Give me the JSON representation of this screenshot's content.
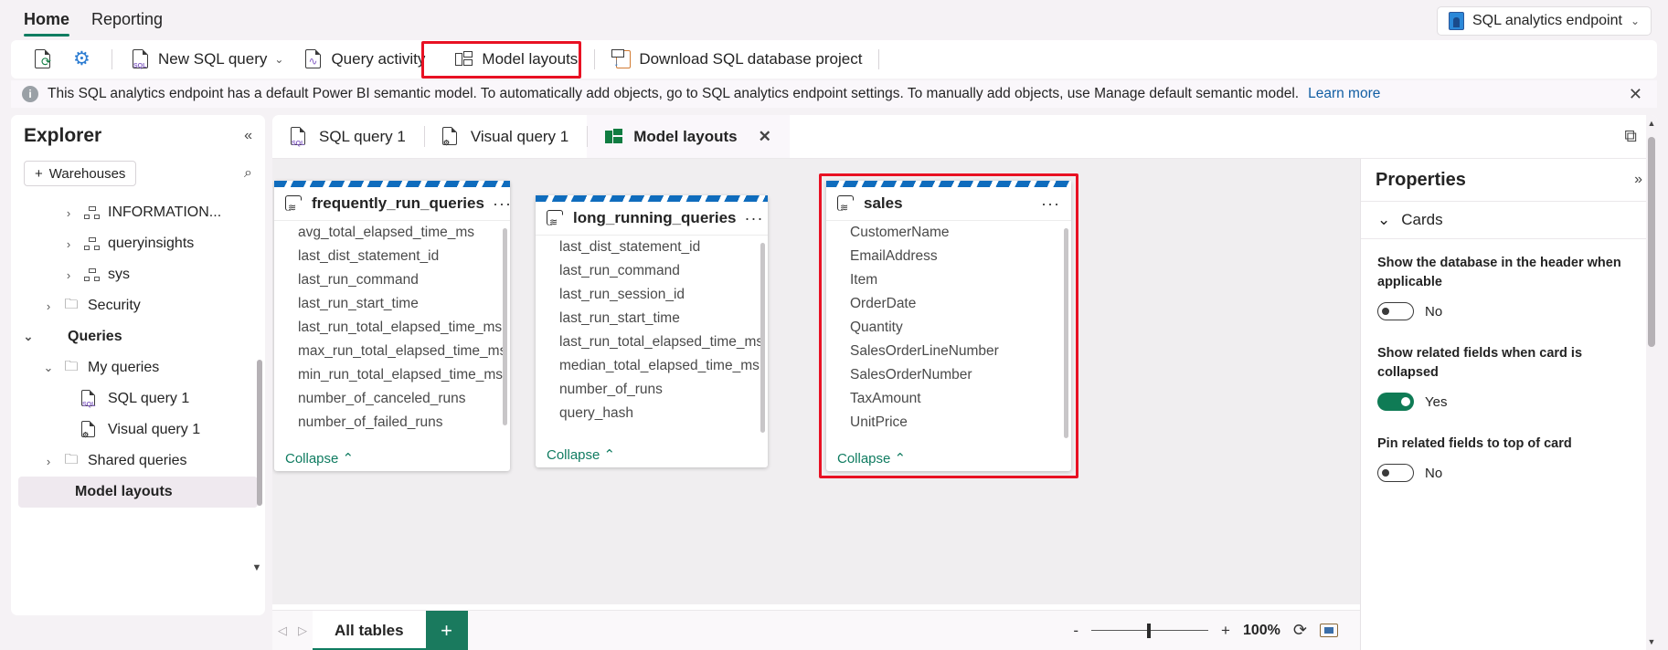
{
  "ribbon": {
    "tabs": [
      {
        "label": "Home",
        "active": true
      },
      {
        "label": "Reporting",
        "active": false
      }
    ],
    "endpoint": {
      "label": "SQL analytics endpoint",
      "icon": "database-icon",
      "chevron": "⌄"
    }
  },
  "commandbar": {
    "items": [
      {
        "label": "",
        "icon": "refresh-page-icon"
      },
      {
        "label": "",
        "icon": "settings-gear-icon"
      },
      {
        "label": "New SQL query",
        "icon": "new-sql-query-icon",
        "chevron": "⌄"
      },
      {
        "label": "Query activity",
        "icon": "query-activity-icon"
      },
      {
        "label": "Model layouts",
        "icon": "model-layouts-icon",
        "highlighted": true
      },
      {
        "label": "Download SQL database project",
        "icon": "download-project-icon"
      }
    ]
  },
  "banner": {
    "icon": "info-icon",
    "text": "This SQL analytics endpoint has a default Power BI semantic model. To automatically add objects, go to SQL analytics endpoint settings. To manually add objects, use Manage default semantic model.",
    "link": "Learn more",
    "close": "✕"
  },
  "explorer": {
    "title": "Explorer",
    "collapse_icon": "«",
    "warehouses_button": "Warehouses",
    "plus": "+",
    "search_icon": "search-icon",
    "tree": [
      {
        "label": "INFORMATION...",
        "caret": "›",
        "icon": "schema-icon",
        "indent": 2,
        "selected": false
      },
      {
        "label": "queryinsights",
        "caret": "›",
        "icon": "schema-icon",
        "indent": 2,
        "selected": false
      },
      {
        "label": "sys",
        "caret": "›",
        "icon": "schema-icon",
        "indent": 2,
        "selected": false
      },
      {
        "label": "Security",
        "caret": "›",
        "icon": "folder-icon",
        "indent": 1,
        "selected": false
      },
      {
        "label": "Queries",
        "caret": "⌄",
        "icon": "",
        "indent": 0,
        "selected": false,
        "bold": true
      },
      {
        "label": "My queries",
        "caret": "⌄",
        "icon": "folder-icon",
        "indent": 1,
        "selected": false
      },
      {
        "label": "SQL query 1",
        "caret": "",
        "icon": "sql-query-icon",
        "indent": 2,
        "selected": false
      },
      {
        "label": "Visual query 1",
        "caret": "",
        "icon": "visual-query-icon",
        "indent": 2,
        "selected": false
      },
      {
        "label": "Shared queries",
        "caret": "›",
        "icon": "folder-icon",
        "indent": 1,
        "selected": false
      },
      {
        "label": "Model layouts",
        "caret": "",
        "icon": "",
        "indent": 0,
        "selected": true
      }
    ]
  },
  "editor": {
    "tabs": [
      {
        "label": "SQL query 1",
        "icon": "sql-query-icon",
        "active": false,
        "closable": false
      },
      {
        "label": "Visual query 1",
        "icon": "visual-query-icon",
        "active": false,
        "closable": false
      },
      {
        "label": "Model layouts",
        "icon": "model-layouts-icon",
        "active": true,
        "closable": true,
        "close": "✕"
      }
    ],
    "copy_icon": "copy-icon"
  },
  "cards": [
    {
      "name": "frequently_run_queries",
      "icon": "table-icon",
      "more": "···",
      "collapse": "Collapse",
      "collapse_caret": "⌃",
      "fields": [
        "avg_total_elapsed_time_ms",
        "last_dist_statement_id",
        "last_run_command",
        "last_run_start_time",
        "last_run_total_elapsed_time_ms",
        "max_run_total_elapsed_time_ms",
        "min_run_total_elapsed_time_ms",
        "number_of_canceled_runs",
        "number_of_failed_runs"
      ]
    },
    {
      "name": "long_running_queries",
      "icon": "table-icon",
      "more": "···",
      "collapse": "Collapse",
      "collapse_caret": "⌃",
      "fields": [
        "last_dist_statement_id",
        "last_run_command",
        "last_run_session_id",
        "last_run_start_time",
        "last_run_total_elapsed_time_ms",
        "median_total_elapsed_time_ms",
        "number_of_runs",
        "query_hash"
      ]
    },
    {
      "name": "sales",
      "icon": "table-icon",
      "more": "···",
      "collapse": "Collapse",
      "collapse_caret": "⌃",
      "highlighted": true,
      "fields": [
        "CustomerName",
        "EmailAddress",
        "Item",
        "OrderDate",
        "Quantity",
        "SalesOrderLineNumber",
        "SalesOrderNumber",
        "TaxAmount",
        "UnitPrice"
      ]
    }
  ],
  "properties": {
    "title": "Properties",
    "expand_icon": "»",
    "section": {
      "label": "Cards",
      "caret": "⌄"
    },
    "settings": [
      {
        "label": "Show the database in the header when applicable",
        "value": "No",
        "on": false
      },
      {
        "label": "Show related fields when card is collapsed",
        "value": "Yes",
        "on": true
      },
      {
        "label": "Pin related fields to top of card",
        "value": "No",
        "on": false
      }
    ]
  },
  "bottombar": {
    "prev": "◁",
    "next": "▷",
    "sheet_tab": "All tables",
    "add": "+",
    "zoom_out": "-",
    "zoom_in": "+",
    "zoom_level": "100%",
    "reset_icon": "reset-icon",
    "fit_icon": "fit-to-screen-icon"
  },
  "colors": {
    "accent": "#107c61",
    "highlight": "#e81123",
    "link": "#115ea3",
    "card_stripe": "#0f6cbd"
  }
}
